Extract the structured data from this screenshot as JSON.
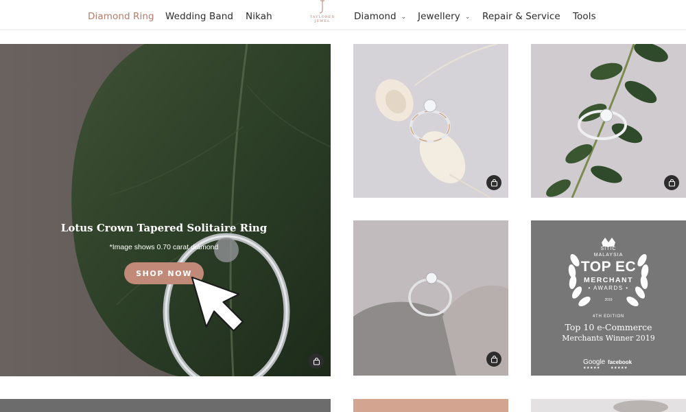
{
  "nav": {
    "items": [
      {
        "label": "Diamond Ring",
        "dropdown": false,
        "active": true
      },
      {
        "label": "Wedding Band",
        "dropdown": false,
        "active": false
      },
      {
        "label": "Nikah",
        "dropdown": false,
        "active": false
      },
      {
        "label": "Diamond",
        "dropdown": true,
        "active": false
      },
      {
        "label": "Jewellery",
        "dropdown": true,
        "active": false
      },
      {
        "label": "Repair & Service",
        "dropdown": false,
        "active": false
      },
      {
        "label": "Tools",
        "dropdown": false,
        "active": false
      }
    ],
    "logo": {
      "line1": "TAYLORED",
      "line2": "JEWEL"
    }
  },
  "hero": {
    "title": "Lotus Crown Tapered Solitaire Ring",
    "subtitle": "*Image shows 0.70 carat diamond",
    "cta": "SHOP NOW"
  },
  "award": {
    "org_small": "SITIC",
    "country": "MALAYSIA",
    "line1": "TOP EC",
    "line2": "MERCHANT",
    "line3": "• AWARDS •",
    "year": "2019",
    "edition": "4TH EDITION",
    "caption1": "Top 10 e-Commerce",
    "caption2": "Merchants Winner 2019",
    "logos": [
      "Google",
      "facebook"
    ],
    "stars": "★★★★★"
  },
  "colors": {
    "accent": "#b47a6b",
    "button": "#c18978",
    "award_bg": "#777777"
  },
  "icons": [
    "shopping-bag-icon",
    "chevron-down-icon",
    "cursor-arrow-icon",
    "laurel-wreath-icon"
  ]
}
